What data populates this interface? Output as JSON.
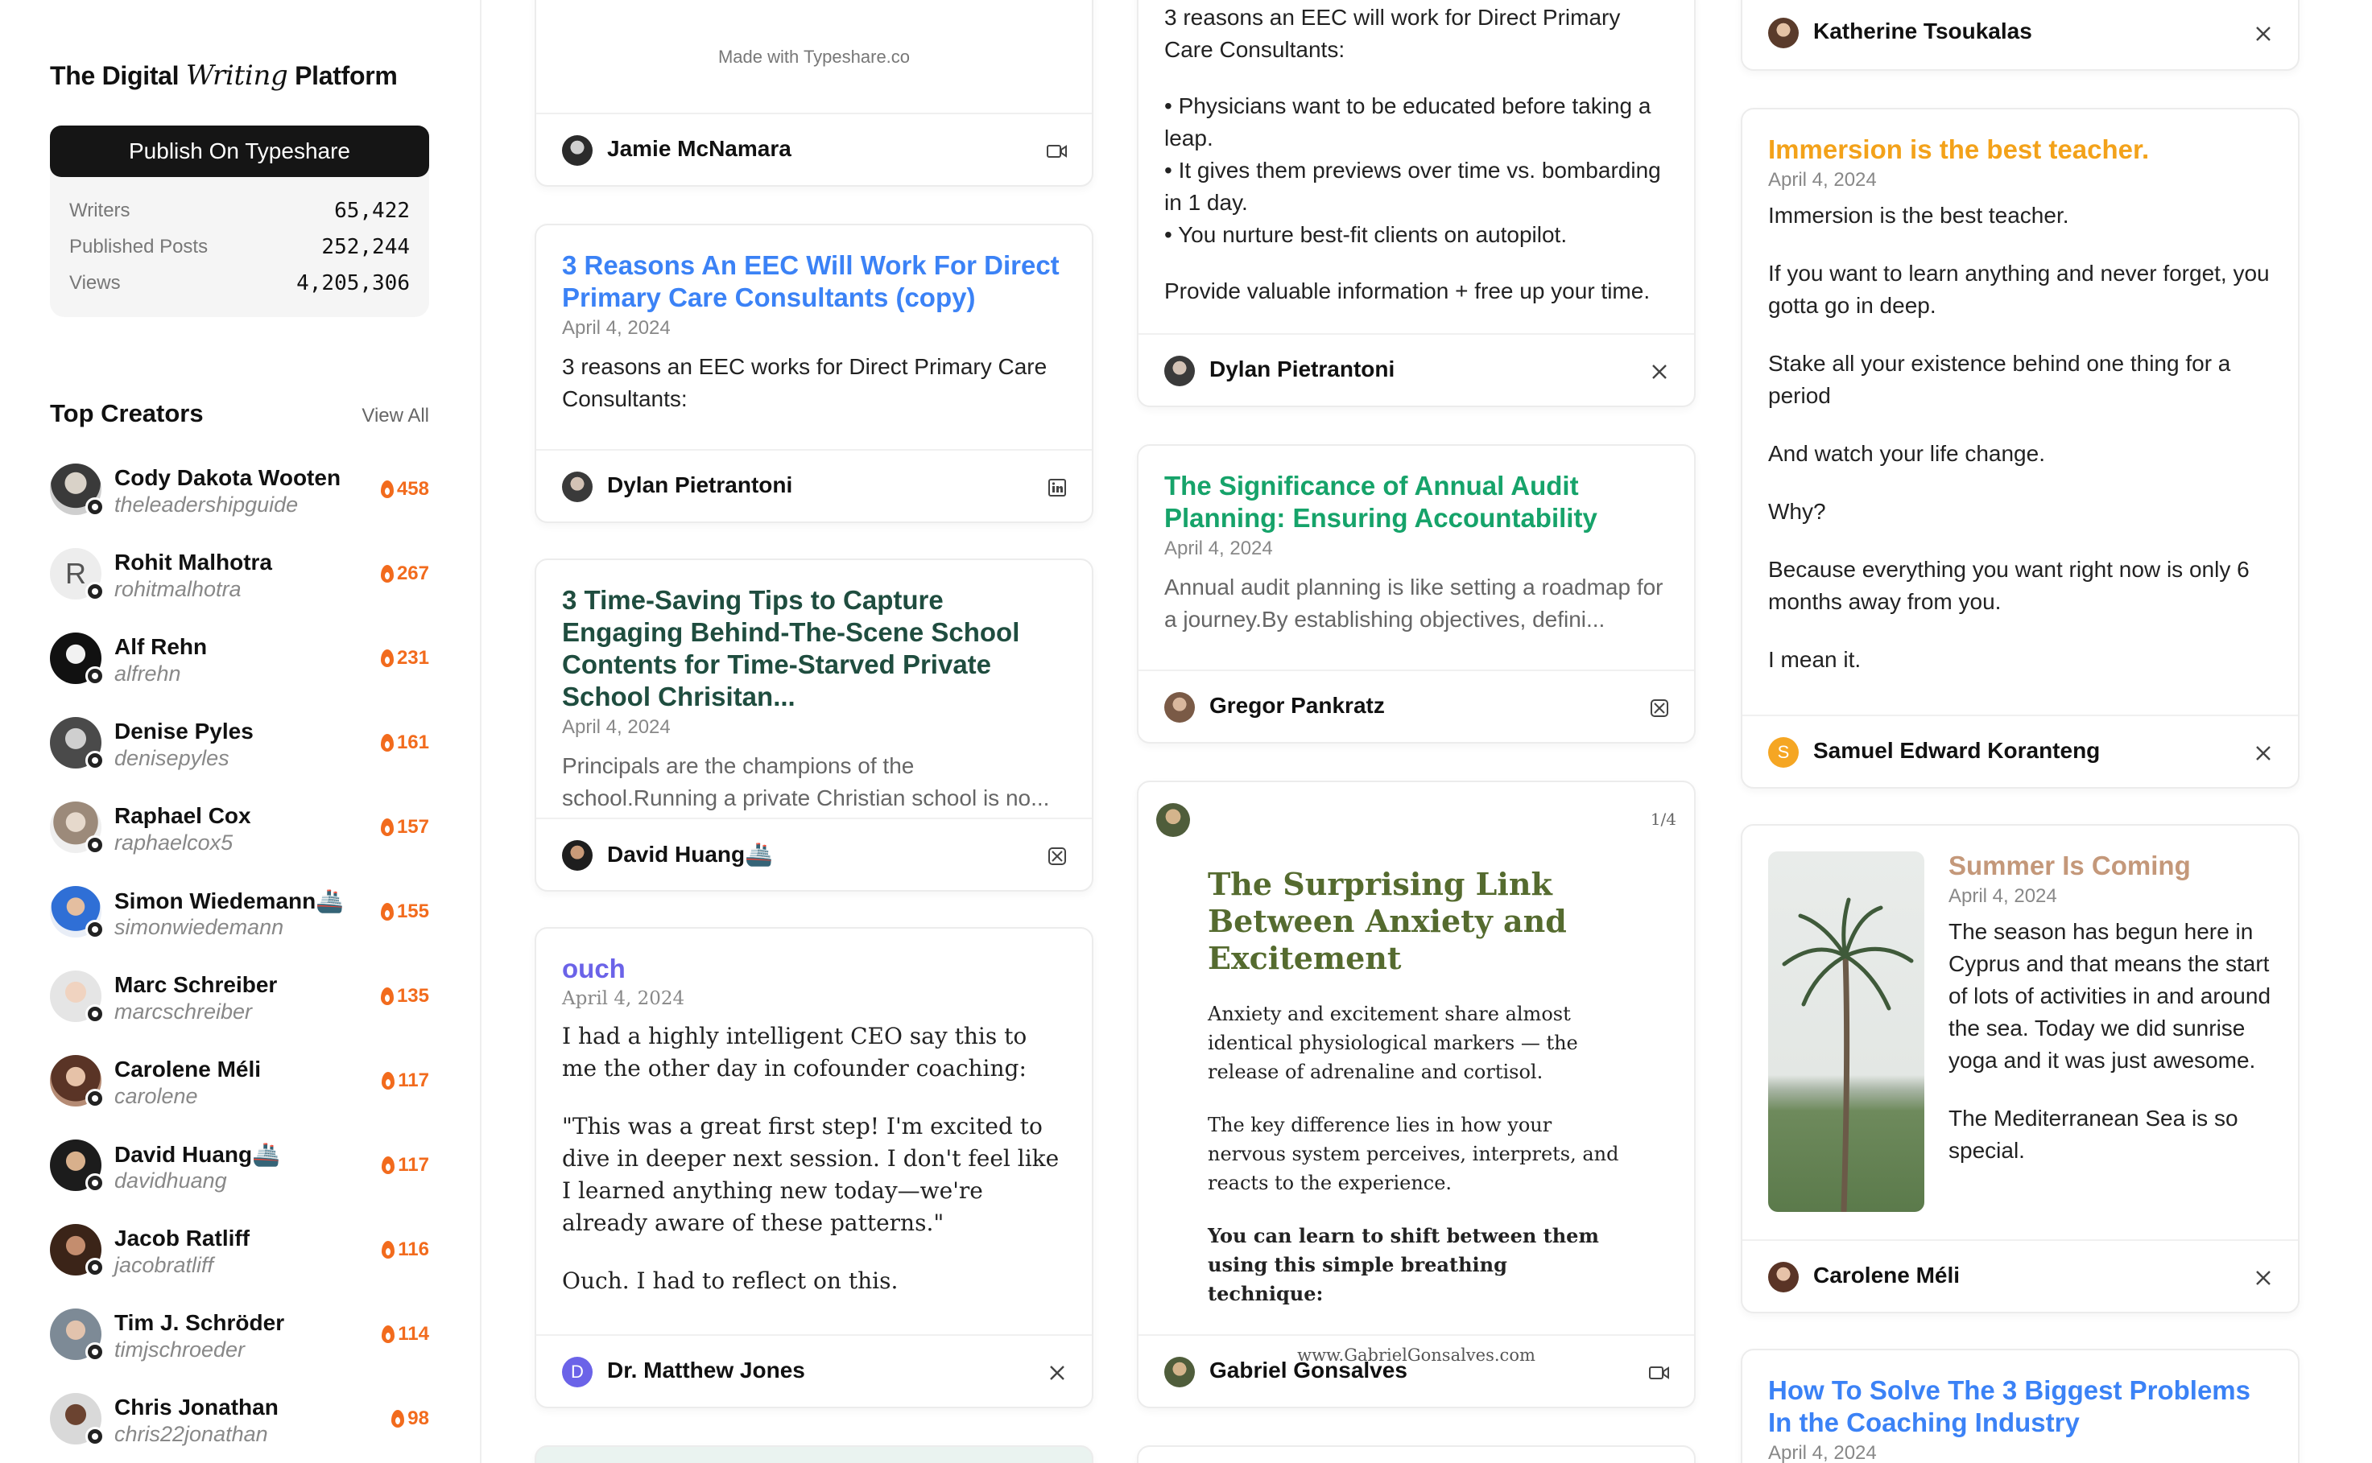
{
  "sidebar": {
    "brand": {
      "prefix": "The Digital",
      "italic": "Writing",
      "suffix": "Platform"
    },
    "publish_button": "Publish On Typeshare",
    "stats": [
      {
        "label": "Writers",
        "value": "65,422"
      },
      {
        "label": "Published Posts",
        "value": "252,244"
      },
      {
        "label": "Views",
        "value": "4,205,306"
      }
    ],
    "top_creators_title": "Top Creators",
    "view_all": "View All",
    "creators": [
      {
        "name": "Cody Dakota Wooten",
        "handle": "theleadershipguide",
        "score": "458"
      },
      {
        "name": "Rohit Malhotra",
        "handle": "rohitmalhotra",
        "score": "267"
      },
      {
        "name": "Alf Rehn",
        "handle": "alfrehn",
        "score": "231"
      },
      {
        "name": "Denise Pyles",
        "handle": "denisepyles",
        "score": "161"
      },
      {
        "name": "Raphael Cox",
        "handle": "raphaelcox5",
        "score": "157"
      },
      {
        "name": "Simon Wiedemann🚢",
        "handle": "simonwiedemann",
        "score": "155"
      },
      {
        "name": "Marc Schreiber",
        "handle": "marcschreiber",
        "score": "135"
      },
      {
        "name": "Carolene Méli",
        "handle": "carolene",
        "score": "117"
      },
      {
        "name": "David Huang🚢",
        "handle": "davidhuang",
        "score": "117"
      },
      {
        "name": "Jacob Ratliff",
        "handle": "jacobratliff",
        "score": "116"
      },
      {
        "name": "Tim J. Schröder",
        "handle": "timjschroeder",
        "score": "114"
      },
      {
        "name": "Chris Jonathan",
        "handle": "chris22jonathan",
        "score": "98"
      }
    ]
  },
  "col1": {
    "card0": {
      "made_with": "Made with Typeshare.co",
      "author": "Jamie McNamara"
    },
    "card1": {
      "title": "3 Reasons An EEC Will Work For Direct Primary Care Consultants (copy)",
      "date": "April 4, 2024",
      "text": "3 reasons an EEC works for Direct Primary Care Consultants:",
      "author": "Dylan Pietrantoni"
    },
    "card2": {
      "title": "3 Time-Saving Tips to Capture Engaging Behind-The-Scene School Contents for Time-Starved Private School Chrisitan...",
      "date": "April 4, 2024",
      "text": "Principals are the champions of the school.Running a private Christian school is no...",
      "author": "David Huang🚢"
    },
    "card3": {
      "title": "ouch",
      "date": "April 4, 2024",
      "p1": "I had a highly intelligent CEO say this to me the other day in cofounder coaching:",
      "p2": "\"This was a great first step! I'm excited to dive in deeper next session. I don't feel like I learned anything new today—we're already aware of these patterns.\"",
      "p3": "Ouch. I had to reflect on this.",
      "author": "Dr. Matthew Jones",
      "author_initial": "D"
    }
  },
  "col2": {
    "card0": {
      "p1": "3 reasons an EEC will work for Direct Primary Care Consultants:",
      "b1": "• Physicians want to be educated before taking a leap.",
      "b2": "• It gives them previews over time vs. bombarding in 1 day.",
      "b3": "• You nurture best-fit clients on autopilot.",
      "p2": "Provide valuable information + free up your time.",
      "author": "Dylan Pietrantoni"
    },
    "card1": {
      "title": "The Significance of Annual Audit Planning: Ensuring Accountability",
      "date": "April 4, 2024",
      "text": "Annual audit planning is like setting a roadmap for a journey.By establishing objectives, defini...",
      "author": "Gregor Pankratz"
    },
    "card2": {
      "page": "1/4",
      "title": "The Surprising Link Between Anxiety and Excitement",
      "p1": "Anxiety and excitement share almost identical physiological markers — the release of adrenaline and cortisol.",
      "p2": "The key difference lies in how your nervous system perceives, interprets, and reacts to the experience.",
      "p3": "You can learn to shift between them using this simple breathing technique:",
      "site": "www.GabrielGonsalves.com",
      "author": "Gabriel Gonsalves"
    }
  },
  "col3": {
    "card0": {
      "author": "Katherine Tsoukalas"
    },
    "card1": {
      "title": "Immersion is the best teacher.",
      "date": "April 4, 2024",
      "p1": "Immersion is the best teacher.",
      "p2": "If you want to learn anything and never forget, you gotta go in deep.",
      "p3": "Stake all your existence behind one thing for a period",
      "p4": "And watch your life change.",
      "p5": "Why?",
      "p6": "Because everything you want right now is only 6 months away from you.",
      "p7": "I mean it.",
      "author": "Samuel Edward Koranteng",
      "author_initial": "S"
    },
    "card2": {
      "title": "Summer Is Coming",
      "date": "April 4, 2024",
      "p1": "The season has begun here in Cyprus and that means the start of lots of activities in and around the sea. Today we did sunrise yoga and it was just awesome.",
      "p2": "The Mediterranean Sea is so special.",
      "author": "Carolene Méli"
    },
    "card3": {
      "title": "How To Solve The 3 Biggest Problems In the Coaching Industry",
      "date": "April 4, 2024"
    }
  },
  "colors": {
    "blue_title": "#3b82f6",
    "dark_green_title": "#1f4d3f",
    "green_title": "#16a36a",
    "purple_title": "#6b63e8",
    "orange_title": "#f3a21a",
    "tan_title": "#c4987a",
    "olive_title": "#556b2f",
    "score_orange": "#f26b1d"
  },
  "icons": {
    "footer_video": "video-icon",
    "footer_linkedin": "linkedin-icon",
    "footer_x": "x-icon",
    "footer_threads": "threads-icon",
    "score": "flame-icon"
  }
}
